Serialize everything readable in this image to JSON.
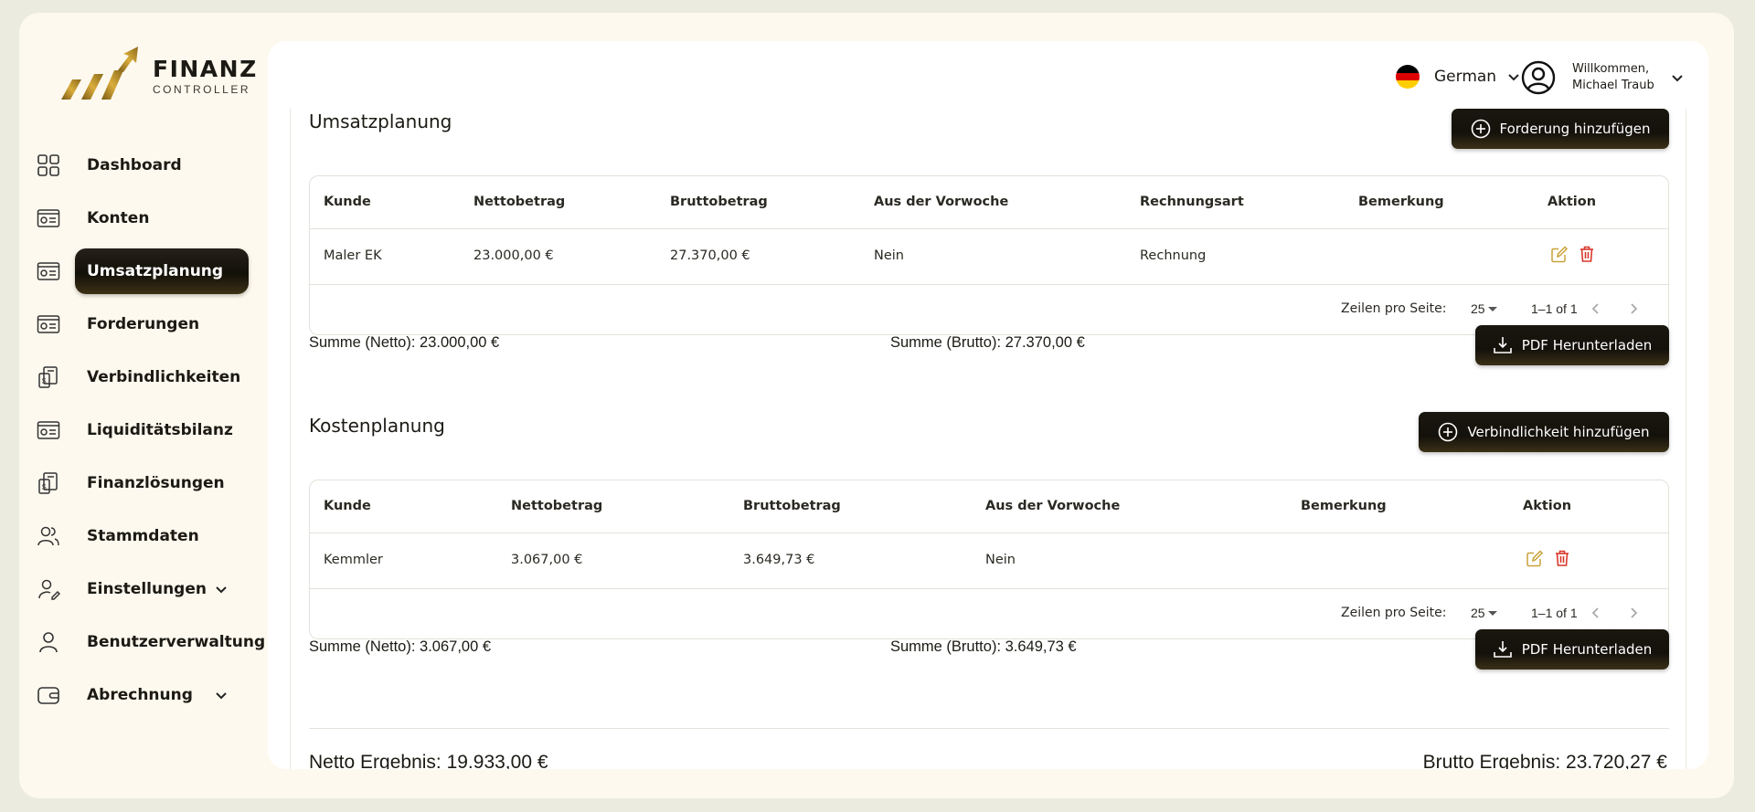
{
  "brand": {
    "title": "FINANZ",
    "subtitle": "CONTROLLER"
  },
  "sidebar": {
    "items": [
      {
        "label": "Dashboard",
        "icon": "grid-icon"
      },
      {
        "label": "Konten",
        "icon": "card-icon"
      },
      {
        "label": "Umsatzplanung",
        "icon": "card-icon",
        "active": true
      },
      {
        "label": "Forderungen",
        "icon": "card-icon"
      },
      {
        "label": "Verbindlichkeiten",
        "icon": "money-doc-icon"
      },
      {
        "label": "Liquiditätsbilanz",
        "icon": "card-icon"
      },
      {
        "label": "Finanzlösungen",
        "icon": "money-doc-icon"
      },
      {
        "label": "Stammdaten",
        "icon": "users-icon"
      },
      {
        "label": "Einstellungen",
        "icon": "user-settings-icon",
        "expandable": true
      },
      {
        "label": "Benutzerverwaltung",
        "icon": "user-icon"
      },
      {
        "label": "Abrechnung",
        "icon": "wallet-icon",
        "expandable": true
      }
    ]
  },
  "header": {
    "language": "German",
    "user_greeting": "Willkommen,",
    "user_name": "Michael Traub"
  },
  "umsatz": {
    "title": "Umsatzplanung",
    "add_button": "Forderung hinzufügen",
    "columns": [
      "Kunde",
      "Nettobetrag",
      "Bruttobetrag",
      "Aus der Vorwoche",
      "Rechnungsart",
      "Bemerkung",
      "Aktion"
    ],
    "rows": [
      {
        "kunde": "Maler EK",
        "netto": "23.000,00 €",
        "brutto": "27.370,00 €",
        "vorwoche": "Nein",
        "rechnungsart": "Rechnung",
        "bemerkung": ""
      }
    ],
    "pager": {
      "label": "Zeilen pro Seite:",
      "per_page": "25",
      "range": "1–1 of 1"
    },
    "sum_netto": "Summe (Netto): 23.000,00 €",
    "sum_brutto": "Summe (Brutto): 27.370,00 €",
    "pdf_button": "PDF Herunterladen"
  },
  "kosten": {
    "title": "Kostenplanung",
    "add_button": "Verbindlichkeit hinzufügen",
    "columns": [
      "Kunde",
      "Nettobetrag",
      "Bruttobetrag",
      "Aus der Vorwoche",
      "Bemerkung",
      "Aktion"
    ],
    "rows": [
      {
        "kunde": "Kemmler",
        "netto": "3.067,00 €",
        "brutto": "3.649,73 €",
        "vorwoche": "Nein",
        "bemerkung": ""
      }
    ],
    "pager": {
      "label": "Zeilen pro Seite:",
      "per_page": "25",
      "range": "1–1 of 1"
    },
    "sum_netto": "Summe (Netto): 3.067,00 €",
    "sum_brutto": "Summe (Brutto): 3.649,73 €",
    "pdf_button": "PDF Herunterladen"
  },
  "result": {
    "netto": "Netto Ergebnis: 19.933,00 €",
    "brutto": "Brutto Ergebnis: 23.720,27 €"
  },
  "colors": {
    "accent_gold": "#c9a23a",
    "dark": "#14110b",
    "delete_red": "#d9372b",
    "edit_gold": "#c9a23a",
    "flag": [
      "#000000",
      "#dd0000",
      "#ffce00"
    ]
  }
}
